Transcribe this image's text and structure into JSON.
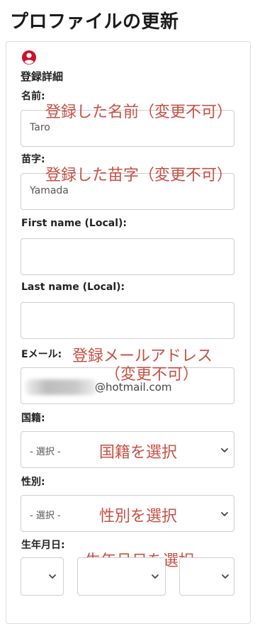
{
  "page": {
    "title": "プロファイルの更新"
  },
  "section": {
    "title": "登録詳細",
    "icon": "person-icon"
  },
  "fields": {
    "last_name_label": "名前:",
    "last_name_value": "Taro",
    "last_name_note": "登録した名前（変更不可）",
    "surname_label": "苗字:",
    "surname_value": "Yamada",
    "surname_note": "登録した苗字（変更不可）",
    "first_name_local_label": "First name (Local):",
    "first_name_local_value": "",
    "last_name_local_label": "Last name (Local):",
    "last_name_local_value": "",
    "email_label": "Eメール:",
    "email_domain": "@hotmail.com",
    "email_note_line1": "登録メールアドレス",
    "email_note_line2": "（変更不可）",
    "nationality_label": "国籍:",
    "nationality_placeholder": "- 選択 -",
    "nationality_note": "国籍を選択",
    "gender_label": "性別:",
    "gender_placeholder": "- 選択 -",
    "gender_note": "性別を選択",
    "dob_label": "生年月日:",
    "dob_note": "生年月日を選択"
  },
  "colors": {
    "accent": "#d0112b",
    "note": "#c0392b",
    "border": "#cfcfcf"
  }
}
